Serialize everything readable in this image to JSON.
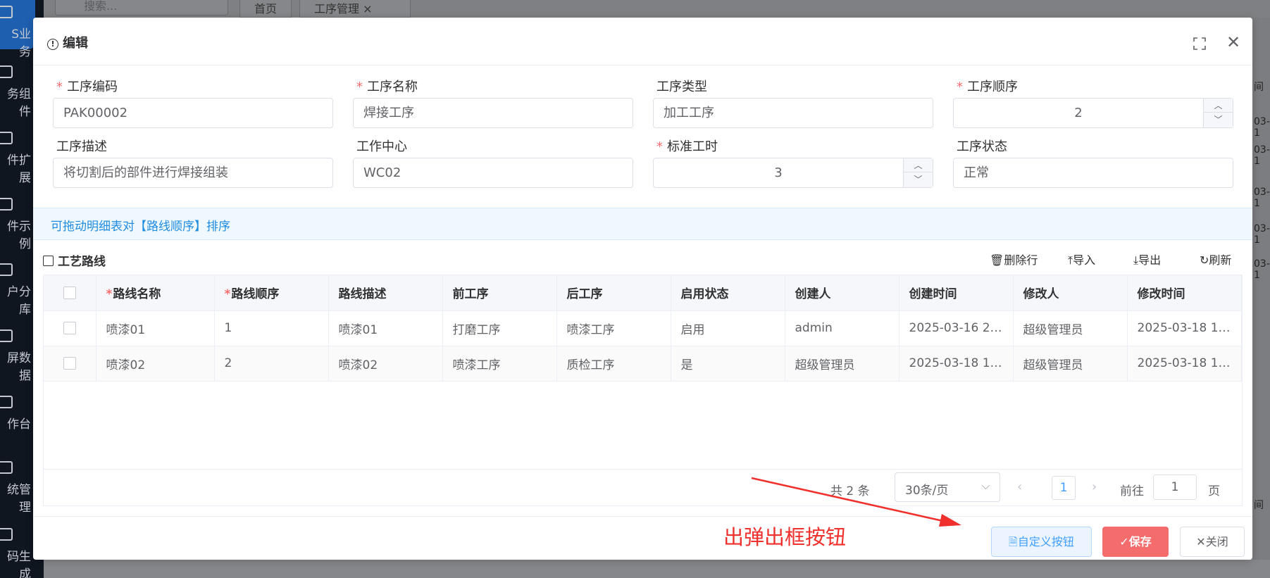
{
  "background": {
    "search_placeholder": "搜索...",
    "tabs": [
      "首页",
      "工序管理 ×"
    ],
    "sidebar": [
      {
        "label": "S业务",
        "icon": "monitor-icon"
      },
      {
        "label": "务组件",
        "icon": "component-icon"
      },
      {
        "label": "件扩展",
        "icon": "edit-icon"
      },
      {
        "label": "件示例",
        "icon": "document-icon"
      },
      {
        "label": "户分库",
        "icon": "user-icon"
      },
      {
        "label": "屏数据",
        "icon": "screen-icon"
      },
      {
        "label": "作台",
        "icon": "folder-icon"
      },
      {
        "label": "统管理",
        "icon": "gear-icon"
      },
      {
        "label": "码生成",
        "icon": "printer-icon"
      }
    ],
    "right_strip": [
      "间",
      "03-1",
      "03-1",
      "03-1",
      "03-1",
      "03-1",
      "间"
    ]
  },
  "dialog": {
    "title": "编辑",
    "hint": "可拖动明细表对【路线顺序】排序",
    "fields": {
      "code": {
        "label": "工序编码",
        "value": "PAK00002",
        "required": true
      },
      "name": {
        "label": "工序名称",
        "value": "焊接工序",
        "required": true
      },
      "type": {
        "label": "工序类型",
        "value": "加工工序",
        "required": false
      },
      "order": {
        "label": "工序顺序",
        "value": "2",
        "required": true
      },
      "desc": {
        "label": "工序描述",
        "value": "将切割后的部件进行焊接组装",
        "required": false
      },
      "center": {
        "label": "工作中心",
        "value": "WC02",
        "required": false
      },
      "std_time": {
        "label": "标准工时",
        "value": "3",
        "required": true
      },
      "status": {
        "label": "工序状态",
        "value": "正常",
        "required": false
      }
    },
    "section_title": "工艺路线",
    "toolbar": {
      "delete": "删除行",
      "import": "导入",
      "export": "导出",
      "refresh": "刷新"
    },
    "table": {
      "columns": [
        "路线名称",
        "路线顺序",
        "路线描述",
        "前工序",
        "后工序",
        "启用状态",
        "创建人",
        "创建时间",
        "修改人",
        "修改时间"
      ],
      "rows": [
        [
          "喷漆01",
          "1",
          "喷漆01",
          "打磨工序",
          "喷漆工序",
          "启用",
          "admin",
          "2025-03-16 2…",
          "超级管理员",
          "2025-03-18 1…"
        ],
        [
          "喷漆02",
          "2",
          "喷漆02",
          "喷漆工序",
          "质检工序",
          "是",
          "超级管理员",
          "2025-03-18 1…",
          "超级管理员",
          "2025-03-18 1…"
        ]
      ]
    },
    "pagination": {
      "total": "共 2 条",
      "page_size": "30条/页",
      "current": "1",
      "goto_label": "前往",
      "goto_value": "1",
      "page_suffix": "页"
    },
    "buttons": {
      "custom": "自定义按钮",
      "save": "保存",
      "close": "关闭"
    }
  },
  "annotation": {
    "text": "出弹出框按钮",
    "color": "#f0302c"
  }
}
